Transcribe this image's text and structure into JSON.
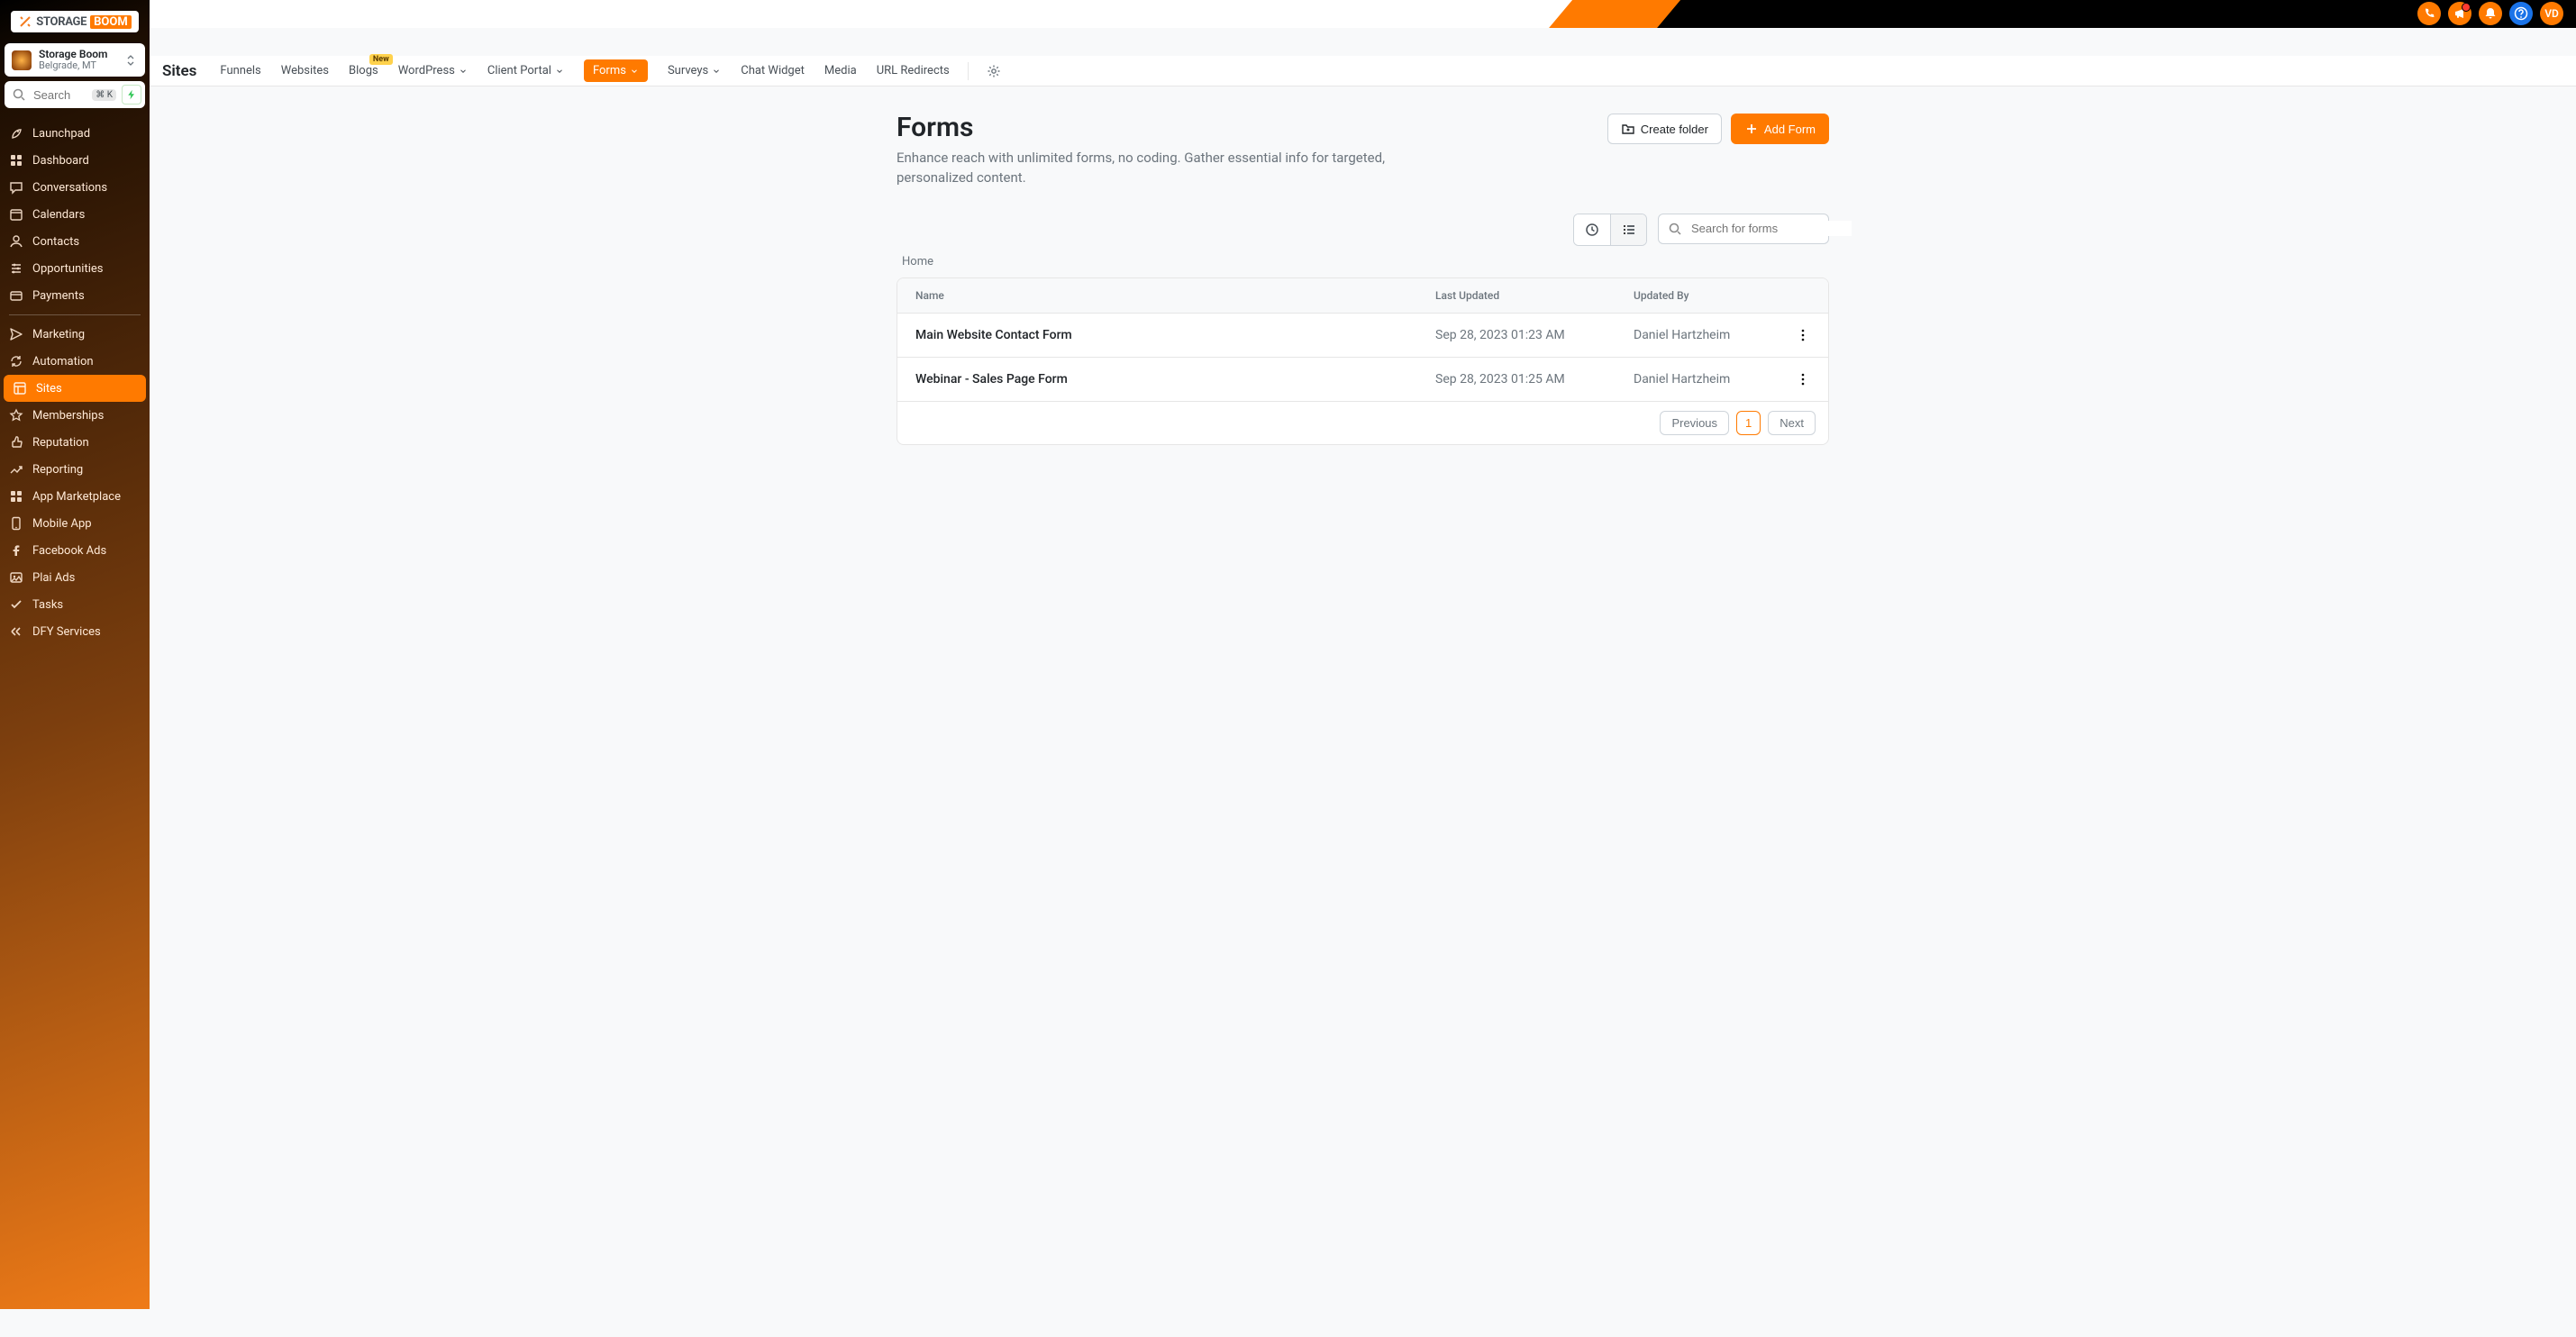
{
  "brand": {
    "part1": "STORAGE",
    "part2": "BOOM"
  },
  "topbar": {
    "avatar_initials": "VD"
  },
  "account": {
    "name": "Storage Boom",
    "location": "Belgrade, MT"
  },
  "search": {
    "placeholder": "Search",
    "shortcut": "⌘ K"
  },
  "sidebar": {
    "items": [
      {
        "label": "Launchpad",
        "icon": "rocket"
      },
      {
        "label": "Dashboard",
        "icon": "grid"
      },
      {
        "label": "Conversations",
        "icon": "chat"
      },
      {
        "label": "Calendars",
        "icon": "calendar"
      },
      {
        "label": "Contacts",
        "icon": "user"
      },
      {
        "label": "Opportunities",
        "icon": "sliders"
      },
      {
        "label": "Payments",
        "icon": "card"
      }
    ],
    "items2": [
      {
        "label": "Marketing",
        "icon": "send"
      },
      {
        "label": "Automation",
        "icon": "refresh"
      },
      {
        "label": "Sites",
        "icon": "layout",
        "active": true
      },
      {
        "label": "Memberships",
        "icon": "star"
      },
      {
        "label": "Reputation",
        "icon": "thumb"
      },
      {
        "label": "Reporting",
        "icon": "trend"
      },
      {
        "label": "App Marketplace",
        "icon": "apps"
      },
      {
        "label": "Mobile App",
        "icon": "phone"
      },
      {
        "label": "Facebook Ads",
        "icon": "fb"
      },
      {
        "label": "Plai Ads",
        "icon": "image"
      },
      {
        "label": "Tasks",
        "icon": "check"
      },
      {
        "label": "DFY Services",
        "icon": "more"
      }
    ]
  },
  "subnav": {
    "title": "Sites",
    "items": [
      {
        "label": "Funnels"
      },
      {
        "label": "Websites"
      },
      {
        "label": "Blogs",
        "badge": "New"
      },
      {
        "label": "WordPress",
        "dropdown": true
      },
      {
        "label": "Client Portal",
        "dropdown": true
      },
      {
        "label": "Forms",
        "dropdown": true,
        "active": true
      },
      {
        "label": "Surveys",
        "dropdown": true
      },
      {
        "label": "Chat Widget"
      },
      {
        "label": "Media"
      },
      {
        "label": "URL Redirects"
      }
    ]
  },
  "page": {
    "title": "Forms",
    "subtitle": "Enhance reach with unlimited forms, no coding. Gather essential info for targeted, personalized content.",
    "create_folder_label": "Create folder",
    "add_form_label": "Add Form",
    "search_placeholder": "Search for forms",
    "breadcrumb": "Home"
  },
  "table": {
    "columns": {
      "name": "Name",
      "updated": "Last Updated",
      "by": "Updated By"
    },
    "rows": [
      {
        "name": "Main Website Contact Form",
        "updated": "Sep 28, 2023 01:23 AM",
        "by": "Daniel Hartzheim"
      },
      {
        "name": "Webinar - Sales Page Form",
        "updated": "Sep 28, 2023 01:25 AM",
        "by": "Daniel Hartzheim"
      }
    ],
    "pagination": {
      "prev": "Previous",
      "current": "1",
      "next": "Next"
    }
  }
}
